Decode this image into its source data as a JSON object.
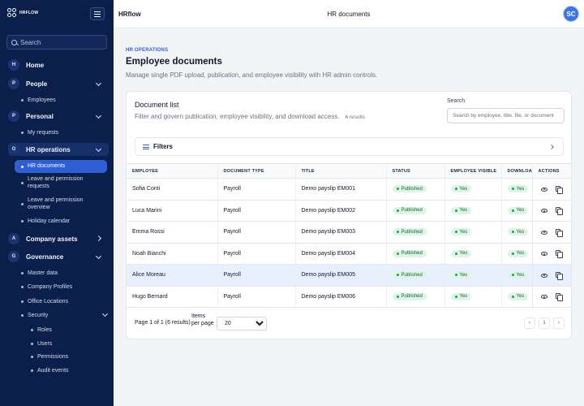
{
  "app": {
    "brand": "HRFLOW",
    "title": "HRflow",
    "page_title": "HR documents",
    "user_initials": "SC"
  },
  "sidebar": {
    "search_placeholder": "Search",
    "groups": [
      {
        "badge": "H",
        "label": "Home"
      },
      {
        "badge": "P",
        "label": "People",
        "items": [
          "Employees"
        ]
      },
      {
        "badge": "P",
        "label": "Personal",
        "items": [
          "My requests"
        ]
      },
      {
        "badge": "O",
        "label": "HR operations",
        "items": [
          "HR documents",
          "Leave and permission requests",
          "Leave and permission overview",
          "Holiday calendar"
        ]
      },
      {
        "badge": "A",
        "label": "Company assets"
      },
      {
        "badge": "G",
        "label": "Governance",
        "items": [
          "Master data",
          "Company Profiles",
          "Office Locations",
          "Security"
        ],
        "security_items": [
          "Roles",
          "Users",
          "Permissions",
          "Audit events"
        ]
      }
    ]
  },
  "header": {
    "eyebrow": "HR OPERATIONS",
    "title": "Employee documents",
    "description": "Manage single PDF upload, publication, and employee visibility with HR admin controls."
  },
  "doc_list": {
    "title": "Document list",
    "subtitle": "Filter and govern publication, employee visibility, and download access.",
    "results": "6 results",
    "search_label": "Search",
    "search_placeholder": "Search by employee, title, file, or document",
    "filters_label": "Filters",
    "columns": [
      "EMPLOYEE",
      "DOCUMENT TYPE",
      "TITLE",
      "STATUS",
      "EMPLOYEE VISIBLE",
      "DOWNLOAD",
      "ACTIONS"
    ],
    "rows": [
      {
        "employee": "Sofia Conti",
        "type": "Payroll",
        "title": "Demo payslip EM001",
        "status": "Published",
        "visible": "Yes",
        "download": "Yes"
      },
      {
        "employee": "Luca Marini",
        "type": "Payroll",
        "title": "Demo payslip EM002",
        "status": "Published",
        "visible": "Yes",
        "download": "Yes"
      },
      {
        "employee": "Emma Rossi",
        "type": "Payroll",
        "title": "Demo payslip EM003",
        "status": "Published",
        "visible": "Yes",
        "download": "Yes"
      },
      {
        "employee": "Noah Bianchi",
        "type": "Payroll",
        "title": "Demo payslip EM004",
        "status": "Published",
        "visible": "Yes",
        "download": "Yes"
      },
      {
        "employee": "Alice Moreau",
        "type": "Payroll",
        "title": "Demo payslip EM005",
        "status": "Published",
        "visible": "Yes",
        "download": "Yes"
      },
      {
        "employee": "Hugo Bernard",
        "type": "Payroll",
        "title": "Demo payslip EM006",
        "status": "Published",
        "visible": "Yes",
        "download": "Yes"
      }
    ],
    "page_info": "Page 1 of 1 (6 results)",
    "items_per_page_label": "Items per page",
    "items_per_page": "20",
    "current_page": "1",
    "prev_glyph": "‹",
    "next_glyph": "›"
  },
  "colors": {
    "sidebar_bg": "#0b1f4b",
    "accent": "#2f5fd6",
    "success": "#16a34a",
    "highlight_row": "#e8effd"
  }
}
